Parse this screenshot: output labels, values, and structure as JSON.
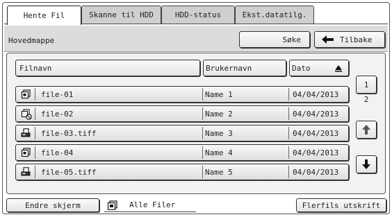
{
  "tabs": [
    "Hente Fil",
    "Skanne til HDD",
    "HDD-status",
    "Ekst.datatilg."
  ],
  "location": "Hovedmappe",
  "search_label": "Søke",
  "back_label": "Tilbake",
  "columns": {
    "name": "Filnavn",
    "user": "Brukernavn",
    "date": "Dato"
  },
  "files": [
    {
      "name": "file-01",
      "user": "Name 1",
      "date": "04/04/2013",
      "icon": "copy-icon"
    },
    {
      "name": "file-02",
      "user": "Name 2",
      "date": "04/04/2013",
      "icon": "copy-restricted-icon"
    },
    {
      "name": "file-03.tiff",
      "user": "Name 3",
      "date": "04/04/2013",
      "icon": "scan-icon"
    },
    {
      "name": "file-04",
      "user": "Name 4",
      "date": "04/04/2013",
      "icon": "copy-icon"
    },
    {
      "name": "file-05.tiff",
      "user": "Name 5",
      "date": "04/04/2013",
      "icon": "scan-icon"
    }
  ],
  "page": {
    "current": "1",
    "total": "2"
  },
  "bottom": {
    "change_screen": "Endre skjerm",
    "filter": "Alle Filer",
    "multi_print": "Flerfils utskrift"
  }
}
